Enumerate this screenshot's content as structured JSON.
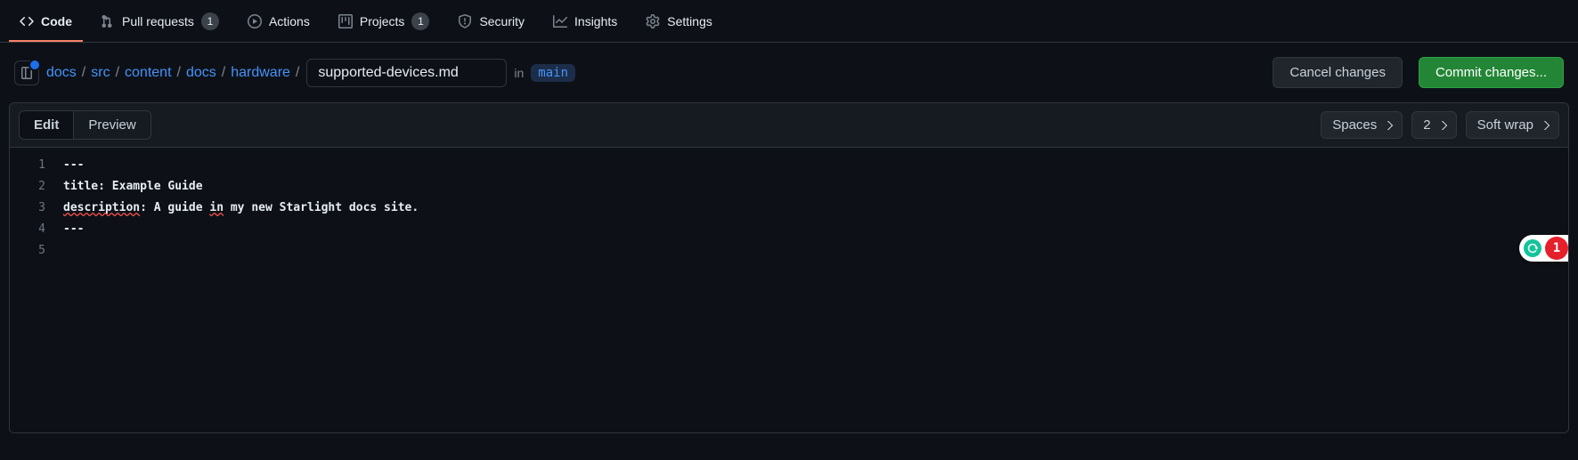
{
  "tabs": {
    "code": "Code",
    "pull_requests": "Pull requests",
    "pull_requests_count": "1",
    "actions": "Actions",
    "projects": "Projects",
    "projects_count": "1",
    "security": "Security",
    "insights": "Insights",
    "settings": "Settings"
  },
  "breadcrumb": {
    "parts": [
      "docs",
      "src",
      "content",
      "docs",
      "hardware"
    ],
    "sep": "/"
  },
  "filename": "supported-devices.md",
  "in_label": "in",
  "branch": "main",
  "buttons": {
    "cancel": "Cancel changes",
    "commit": "Commit changes..."
  },
  "editor_tabs": {
    "edit": "Edit",
    "preview": "Preview"
  },
  "dropdowns": {
    "indent": "Spaces",
    "size": "2",
    "wrap": "Soft wrap"
  },
  "code": {
    "lines": [
      {
        "n": "1",
        "segments": [
          {
            "t": "---",
            "cls": "tok-bold"
          }
        ]
      },
      {
        "n": "2",
        "segments": [
          {
            "t": "title: Example Guide",
            "cls": "tok-bold"
          }
        ]
      },
      {
        "n": "3",
        "segments": [
          {
            "t": "description",
            "cls": "tok-bold spell"
          },
          {
            "t": ": A guide ",
            "cls": "tok-bold"
          },
          {
            "t": "in",
            "cls": "tok-bold spell"
          },
          {
            "t": " my new Starlight docs site.",
            "cls": "tok-bold"
          }
        ]
      },
      {
        "n": "4",
        "segments": [
          {
            "t": "---",
            "cls": "tok-bold"
          }
        ]
      },
      {
        "n": "5",
        "segments": [
          {
            "t": "",
            "cls": "tok-plain"
          }
        ]
      }
    ]
  },
  "grammarly_count": "1"
}
